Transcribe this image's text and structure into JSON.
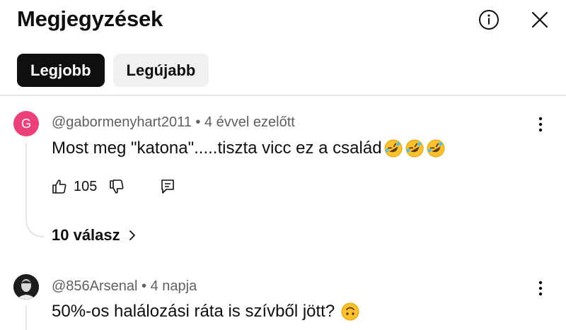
{
  "header": {
    "title": "Megjegyzések",
    "info_icon": "info-icon",
    "close_icon": "close-icon"
  },
  "chips": [
    {
      "label": "Legjobb",
      "selected": true
    },
    {
      "label": "Legújabb",
      "selected": false
    }
  ],
  "comments": [
    {
      "avatar_letter": "G",
      "avatar_color": "#ec407a",
      "author": "@gabormenyhart2011",
      "separator": "•",
      "time": "4 évvel ezelőtt",
      "text": "Most meg \"katona\".....tiszta vicc ez a család",
      "emoji": "rolling-on-floor-laughing x3",
      "likes": "105",
      "replies": "10 válasz"
    },
    {
      "avatar_letter": "",
      "author": "@856Arsenal",
      "separator": "•",
      "time": "4 napja",
      "text": "50%-os halálozási ráta is szívből jött?",
      "emoji": "upside-down-face"
    }
  ],
  "colors": {
    "text": "#0f0f0f",
    "secondary": "#606060",
    "chip_active_bg": "#0f0f0f",
    "chip_inactive_bg": "#f0f0f0",
    "divider": "#e5e5e5"
  }
}
